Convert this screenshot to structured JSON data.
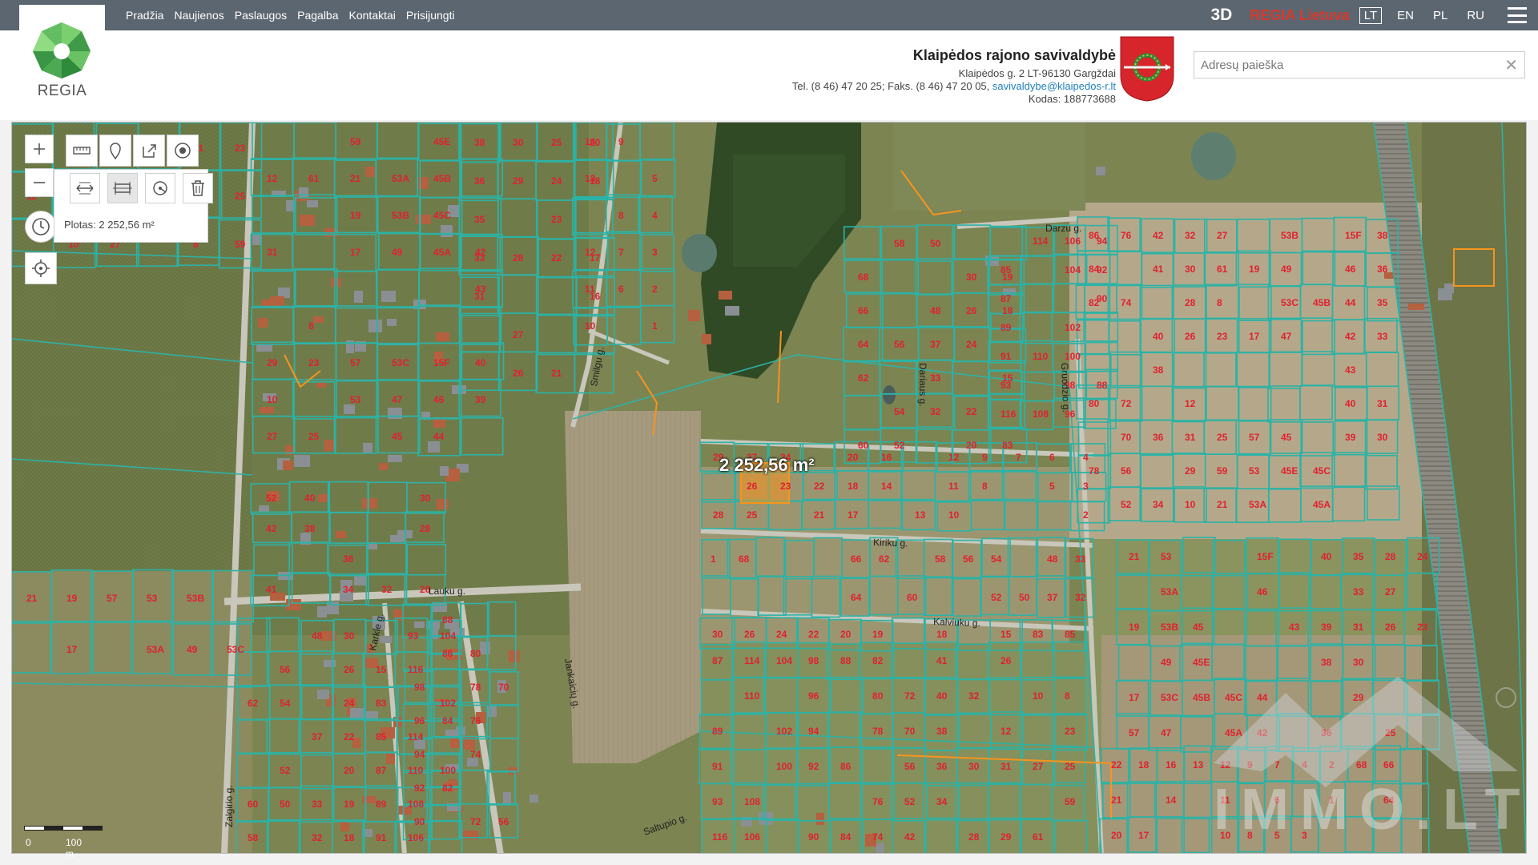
{
  "nav": {
    "items": [
      "Pradžia",
      "Naujienos",
      "Paslaugos",
      "Pagalba",
      "Kontaktai",
      "Prisijungti"
    ]
  },
  "topright": {
    "btn_3d": "3D",
    "brand": "REGIA Lietuva",
    "languages": [
      "LT",
      "EN",
      "PL",
      "RU"
    ],
    "active_language": "LT"
  },
  "logo": {
    "text": "REGIA"
  },
  "municipality": {
    "name": "Klaipėdos rajono savivaldybė",
    "address": "Klaipėdos g. 2 LT-96130 Gargždai",
    "phone": "Tel. (8 46) 47 20 25; Faks. (8 46) 47 20 05, ",
    "email": "savivaldybe@klaipedos-r.lt",
    "code": "Kodas: 188773688"
  },
  "search": {
    "placeholder": "Adresų paieška",
    "value": ""
  },
  "tools": {
    "area_label": "Plotas: 2 252,56 m²"
  },
  "map": {
    "measure_label": "2 252,56 m²",
    "scale_zero": "0",
    "scale_label": "100 m",
    "streets": [
      "Lauku g.",
      "Kalviuku g.",
      "Kiriku g.",
      "Darzu g.",
      "Saltupio g.",
      "Jankaicių g.",
      "Zalgirio g.",
      "Karkle g.",
      "Gruodzio g.",
      "Dariaus g.",
      "Smilgu g."
    ],
    "parcel_numbers": [
      "12",
      "31",
      "29",
      "10",
      "27",
      "61",
      "8",
      "23",
      "25",
      "59",
      "21",
      "19",
      "17",
      "57",
      "53",
      "53A",
      "53B",
      "49",
      "53C",
      "47",
      "45",
      "45E",
      "45B",
      "45C",
      "45A",
      "15F",
      "46",
      "44",
      "42",
      "43",
      "40",
      "39",
      "38",
      "36",
      "35",
      "33",
      "31",
      "30",
      "29",
      "28",
      "27",
      "26",
      "25",
      "24",
      "23",
      "22",
      "21",
      "20",
      "18",
      "17",
      "16",
      "14",
      "13",
      "12",
      "11",
      "10",
      "9",
      "8",
      "7",
      "6",
      "5",
      "4",
      "3",
      "2",
      "1",
      "68",
      "66",
      "64",
      "62",
      "60",
      "58",
      "56",
      "54",
      "52",
      "50",
      "48",
      "37",
      "33",
      "32",
      "30",
      "26",
      "24",
      "22",
      "20",
      "19",
      "18",
      "15",
      "83",
      "85",
      "87",
      "89",
      "91",
      "93",
      "116",
      "114",
      "110",
      "108",
      "106",
      "104",
      "102",
      "100",
      "98",
      "96",
      "94",
      "92",
      "90",
      "88",
      "86",
      "84",
      "82",
      "80",
      "78",
      "76",
      "74",
      "72",
      "70",
      "56",
      "52",
      "42",
      "41",
      "40",
      "38",
      "36",
      "34",
      "32",
      "30",
      "28",
      "26"
    ],
    "watermark": "IMMO.LT"
  },
  "colors": {
    "topbar": "#5b6670",
    "parcel_line": "#2bb3a6",
    "parcel_label": "#e0212f",
    "highlight": "#f7941d",
    "brand_red": "#d9382b"
  }
}
